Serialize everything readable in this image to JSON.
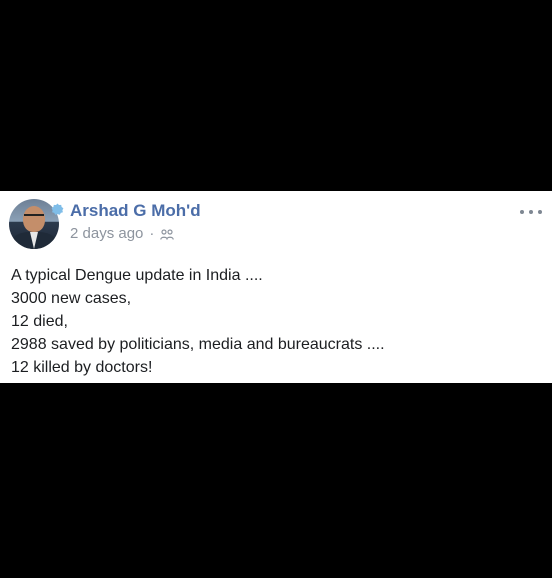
{
  "post": {
    "author": "Arshad G Moh'd",
    "timestamp": "2 days ago",
    "separator": "·",
    "audience_icon": "friends-icon",
    "badge_icon": "verified-badge-icon",
    "more_icon": "more-options-icon",
    "lines": [
      "A typical Dengue update in India ....",
      "3000 new cases,",
      "12 died,",
      "2988 saved by politicians, media and bureaucrats ....",
      "12 killed by doctors!"
    ]
  },
  "colors": {
    "author_name": "#4b6da8",
    "meta_text": "#8d949e",
    "body_text": "#1c1e21",
    "card_bg": "#ffffff",
    "page_bg": "#000000"
  }
}
